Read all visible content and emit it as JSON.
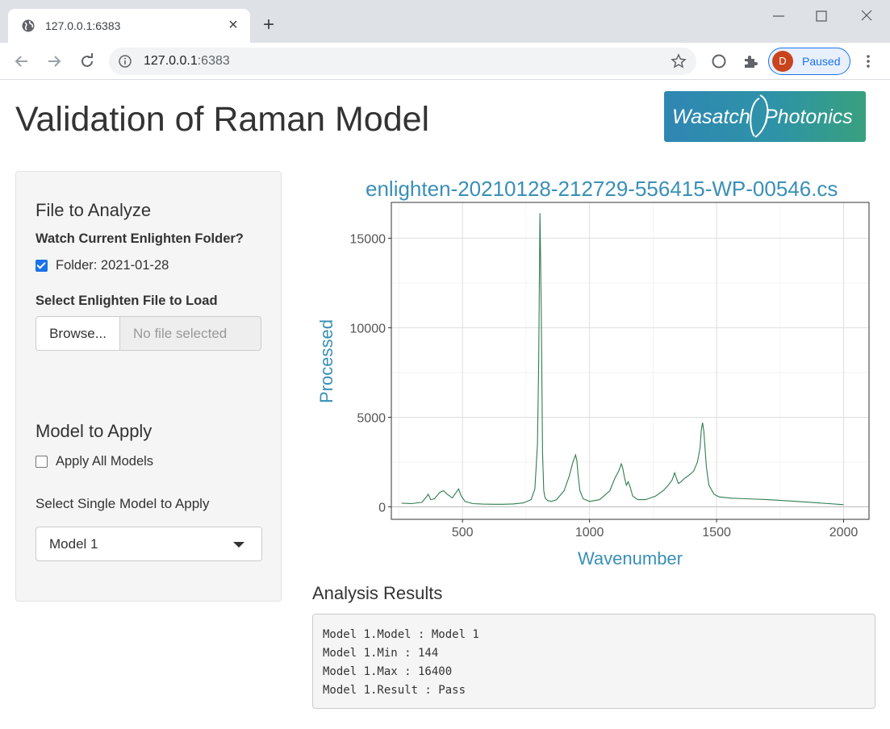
{
  "browser": {
    "tab_title": "127.0.0.1:6383",
    "url_host": "127.0.0.1",
    "url_port": ":6383",
    "profile_initial": "D",
    "profile_status": "Paused"
  },
  "page": {
    "title": "Validation of Raman Model",
    "logo_text_a": "Wasatch",
    "logo_text_b": "Photonics"
  },
  "sidebar": {
    "file_section_title": "File to Analyze",
    "watch_label": "Watch Current Enlighten Folder?",
    "folder_checkbox_label": "Folder: 2021-01-28",
    "folder_checked": true,
    "select_file_label": "Select Enlighten File to Load",
    "browse_label": "Browse...",
    "file_placeholder": "No file selected",
    "model_section_title": "Model to Apply",
    "apply_all_label": "Apply All Models",
    "apply_all_checked": false,
    "single_model_label": "Select Single Model to Apply",
    "selected_model": "Model 1"
  },
  "chart_data": {
    "type": "line",
    "title": "enlighten-20210128-212729-556415-WP-00546.cs",
    "xlabel": "Wavenumber",
    "ylabel": "Processed",
    "xlim": [
      220,
      2100
    ],
    "ylim": [
      -700,
      17000
    ],
    "xticks": [
      500,
      1000,
      1500,
      2000
    ],
    "yticks": [
      0,
      5000,
      10000,
      15000
    ],
    "grid": true,
    "line_color": "#2e7d4f",
    "series": [
      {
        "x": [
          260,
          300,
          340,
          355,
          365,
          375,
          390,
          410,
          425,
          440,
          460,
          475,
          485,
          495,
          510,
          540,
          580,
          620,
          660,
          700,
          740,
          770,
          785,
          795,
          800,
          805,
          810,
          815,
          820,
          825,
          835,
          850,
          870,
          900,
          920,
          935,
          945,
          950,
          955,
          962,
          975,
          1000,
          1040,
          1080,
          1100,
          1115,
          1125,
          1130,
          1138,
          1145,
          1152,
          1160,
          1170,
          1190,
          1220,
          1260,
          1290,
          1310,
          1325,
          1335,
          1342,
          1350,
          1360,
          1375,
          1395,
          1410,
          1425,
          1435,
          1440,
          1445,
          1450,
          1455,
          1460,
          1470,
          1490,
          1510,
          1560,
          1620,
          1700,
          1800,
          1900,
          2000
        ],
        "y": [
          200,
          180,
          250,
          500,
          700,
          400,
          450,
          800,
          900,
          700,
          500,
          800,
          1000,
          600,
          300,
          180,
          150,
          140,
          144,
          160,
          220,
          400,
          1000,
          3500,
          8000,
          16400,
          11000,
          3000,
          900,
          500,
          350,
          300,
          400,
          900,
          1700,
          2500,
          2900,
          2600,
          1800,
          900,
          450,
          300,
          400,
          900,
          1600,
          2000,
          2400,
          2200,
          1600,
          1200,
          1400,
          1100,
          600,
          400,
          400,
          600,
          900,
          1200,
          1500,
          1900,
          1600,
          1300,
          1400,
          1600,
          1800,
          2000,
          2500,
          3300,
          4300,
          4700,
          4200,
          3200,
          2200,
          1200,
          700,
          550,
          480,
          450,
          400,
          320,
          220,
          120
        ]
      }
    ]
  },
  "results": {
    "title": "Analysis Results",
    "lines": [
      "Model 1.Model : Model 1",
      "Model 1.Min : 144",
      "Model 1.Max : 16400",
      "Model 1.Result : Pass"
    ]
  }
}
